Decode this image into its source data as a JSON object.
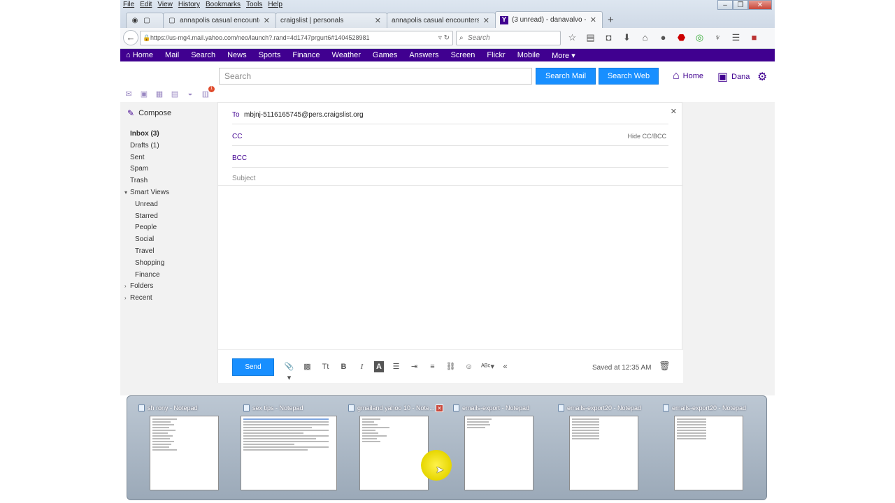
{
  "menubar": [
    "File",
    "Edit",
    "View",
    "History",
    "Bookmarks",
    "Tools",
    "Help"
  ],
  "tabs": [
    {
      "title": "annapolis casual encounters \"..."
    },
    {
      "title": "craigslist | personals"
    },
    {
      "title": "annapolis casual encounters \"..."
    },
    {
      "title": "(3 unread) - danavalvo - Ya..."
    }
  ],
  "url": "https://us-mg4.mail.yahoo.com/neo/launch?.rand=4d1747prgurt6#1404528981",
  "browser_search_placeholder": "Search",
  "ybar": [
    "Home",
    "Mail",
    "Search",
    "News",
    "Sports",
    "Finance",
    "Weather",
    "Games",
    "Answers",
    "Screen",
    "Flickr",
    "Mobile",
    "More ▾"
  ],
  "yhead": {
    "search_placeholder": "Search",
    "search_mail": "Search Mail",
    "search_web": "Search Web",
    "home": "Home",
    "user": "Dana",
    "badge": "1"
  },
  "left": {
    "compose": "Compose",
    "folders": [
      {
        "label": "Inbox (3)",
        "bold": true
      },
      {
        "label": "Drafts (1)"
      },
      {
        "label": "Sent"
      },
      {
        "label": "Spam"
      },
      {
        "label": "Trash"
      },
      {
        "label": "Smart Views",
        "caret": "▾"
      },
      {
        "label": "Unread",
        "sub": true
      },
      {
        "label": "Starred",
        "sub": true
      },
      {
        "label": "People",
        "sub": true
      },
      {
        "label": "Social",
        "sub": true
      },
      {
        "label": "Travel",
        "sub": true
      },
      {
        "label": "Shopping",
        "sub": true
      },
      {
        "label": "Finance",
        "sub": true
      },
      {
        "label": "Folders",
        "caret": "›"
      },
      {
        "label": "Recent",
        "caret": "›"
      }
    ]
  },
  "compose": {
    "to_label": "To",
    "to_value": "mbjnj-5116165745@pers.craigslist.org",
    "cc_label": "CC",
    "bcc_label": "BCC",
    "hide_cc": "Hide CC/BCC",
    "subject_placeholder": "Subject",
    "send": "Send",
    "saved": "Saved at 12:35 AM"
  },
  "thumbnails": [
    {
      "title": "sh rony - Notepad"
    },
    {
      "title": "sex tips - Notepad"
    },
    {
      "title": "gmailand yahoo 10 - Note..."
    },
    {
      "title": "emails-export - Notepad"
    },
    {
      "title": "emails-export20 - Notepad"
    },
    {
      "title": "emails-export20 - Notepad"
    }
  ],
  "colors": {
    "yahoo_purple": "#400090",
    "button_blue": "#188fff"
  }
}
